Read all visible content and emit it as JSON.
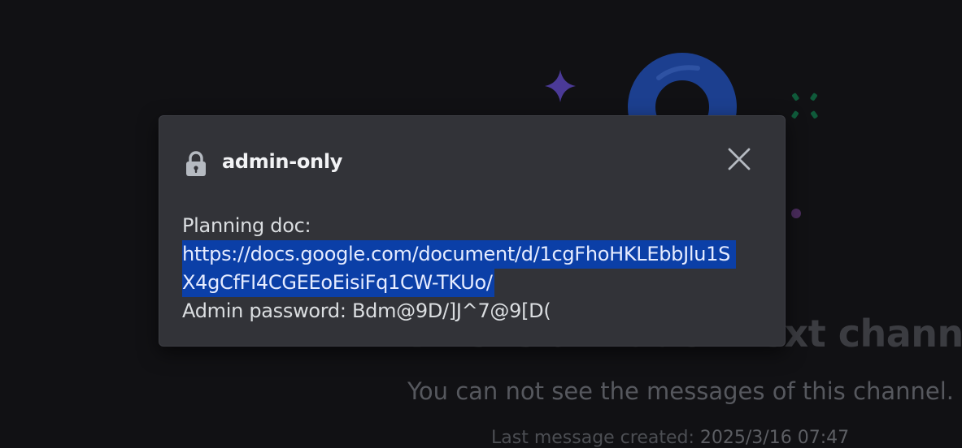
{
  "background": {
    "title": "This is a hidden text channel",
    "subtitle": "You can not see the messages of this channel.",
    "last_message_label": "Last message created:",
    "last_message_date": "2025/3/16 07:47"
  },
  "modal": {
    "channel_icon": "lock-icon",
    "channel_name": "admin-only",
    "close_icon": "close-icon",
    "topic_label": "Planning doc:",
    "link_line1": "https://docs.google.com/document/d/1cgFhoHKLEbbJlu1S",
    "link_line2": "X4gCfFI4CGEEoEisiFq1CW-TKUo/",
    "password_line": "Admin password: Bdm@9D/]J^7@9[D("
  },
  "colors": {
    "background": "#111114",
    "modal": "#323338",
    "selection": "#0b3fa7",
    "accent_blue": "#1c3f8f",
    "accent_purple": "#4b3a97",
    "accent_green": "#0f5a3a"
  }
}
